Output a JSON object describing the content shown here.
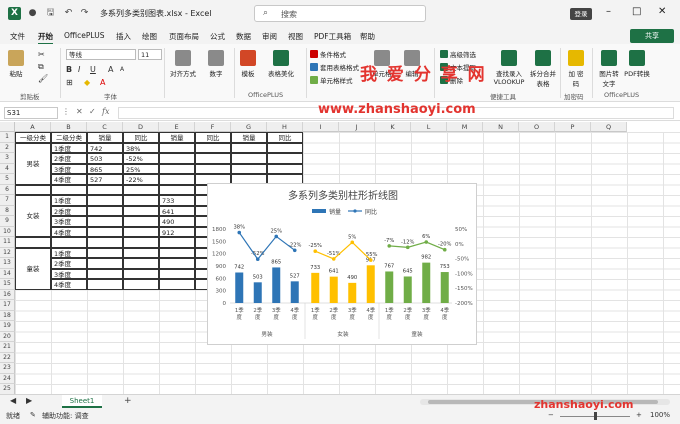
{
  "window": {
    "file_title": "多系列多类别图表.xlsx  -  Excel",
    "search_placeholder": "搜索",
    "login_label": "登录",
    "minimize_icon": "–",
    "restore_icon": "□",
    "close_icon": "✕"
  },
  "menu": {
    "tabs": [
      "文件",
      "开始",
      "OfficePLUS",
      "插入",
      "绘图",
      "页面布局",
      "公式",
      "数据",
      "审阅",
      "视图",
      "PDF工具箱",
      "帮助"
    ],
    "active": "开始",
    "share_label": "共享"
  },
  "ribbon": {
    "paste_label": "粘贴",
    "clipboard_group": "剪贴板",
    "font_name": "等线",
    "font_size": "11",
    "font_group": "字体",
    "align_label": "对齐方式",
    "number_label": "数字",
    "template_label": "模板",
    "beautify_label": "表格美化",
    "officeplus_group": "OfficePLUS",
    "cond_format_label": "条件格式",
    "table_format_label": "套用表格格式",
    "cell_style_label": "单元格样式",
    "cells_label": "单元格",
    "edit_label": "编辑",
    "adv_filter_label": "高级筛选",
    "text_extract_label": "文本提取",
    "dup_label": "删除",
    "vlookup_label": "查找录入 VLOOKUP",
    "split_merge_label": "拆分合并 表格",
    "tools_group": "便捷工具",
    "encrypt_label": "加 密码",
    "encrypt_group": "加密码",
    "img_to_text_label": "图片转 文字",
    "pdf_convert_label": "PDF转换",
    "officeplus_group2": "OfficePLUS",
    "watermark_text": "我 爱 分 享 网"
  },
  "formula_bar": {
    "name_box": "S31",
    "fx_label": "fx",
    "watermark_url": "www.zhanshaoyi.com"
  },
  "grid": {
    "columns": [
      "A",
      "B",
      "C",
      "D",
      "E",
      "F",
      "G",
      "H",
      "I",
      "J",
      "K",
      "L",
      "M",
      "N",
      "O",
      "P",
      "Q"
    ],
    "rows": [
      "1",
      "2",
      "3",
      "4",
      "5",
      "6",
      "7",
      "8",
      "9",
      "10",
      "11",
      "12",
      "13",
      "14",
      "15",
      "16",
      "17",
      "18",
      "19",
      "20",
      "21",
      "22",
      "23",
      "24",
      "25"
    ],
    "header": [
      "一级分类",
      "二级分类",
      "销量",
      "同比",
      "销量",
      "同比",
      "销量",
      "同比"
    ],
    "groups": [
      {
        "name": "男装",
        "quarters": [
          "1季度",
          "2季度",
          "3季度",
          "4季度"
        ],
        "sales": [
          "742",
          "503",
          "865",
          "527"
        ],
        "yoy": [
          "38%",
          "-52%",
          "25%",
          "-22%"
        ]
      },
      {
        "name": "女装",
        "quarters": [
          "1季度",
          "2季度",
          "3季度",
          "4季度"
        ],
        "sales": [
          "733",
          "641",
          "490",
          "912"
        ],
        "yoy": [
          "",
          "",
          "",
          ""
        ]
      },
      {
        "name": "童装",
        "quarters": [
          "1季度",
          "2季度",
          "3季度",
          "4季度"
        ],
        "sales": [
          "",
          "",
          "",
          ""
        ],
        "yoy": [
          "",
          "",
          "",
          ""
        ]
      }
    ]
  },
  "chart_data": {
    "type": "bar",
    "title": "多系列多类别柱形折线图",
    "legend": [
      "销量",
      "同比"
    ],
    "legend_position": "top",
    "categories": [
      "1季度",
      "2季度",
      "3季度",
      "4季度"
    ],
    "groups": [
      "男装",
      "女装",
      "童装"
    ],
    "series": [
      {
        "name": "销量",
        "kind": "bar",
        "axis": "left",
        "values": [
          [
            742,
            503,
            865,
            527
          ],
          [
            733,
            641,
            490,
            917
          ],
          [
            767,
            645,
            982,
            753
          ]
        ]
      },
      {
        "name": "同比",
        "kind": "line",
        "axis": "right",
        "values": [
          [
            38,
            -52,
            25,
            -22
          ],
          [
            -25,
            -51,
            5,
            -55
          ],
          [
            -7,
            -12,
            6,
            -20
          ]
        ]
      }
    ],
    "value_labels": [
      [
        "742",
        "503",
        "865",
        "527"
      ],
      [
        "733",
        "641",
        "490",
        "917"
      ],
      [
        "767",
        "645",
        "982",
        "753"
      ]
    ],
    "pct_labels": [
      [
        "38%",
        "-52%",
        "25%",
        "-22%"
      ],
      [
        "-25%",
        "-51%",
        "5%",
        "-55%"
      ],
      [
        "-7%",
        "-12%",
        "6%",
        "-20%"
      ]
    ],
    "group_colors": [
      "#2e75b6",
      "#ffc000",
      "#70ad47"
    ],
    "y_left": {
      "ticks": [
        "1800",
        "1500",
        "1200",
        "900",
        "600",
        "300",
        "0"
      ],
      "range": [
        0,
        1800
      ]
    },
    "y_right": {
      "ticks": [
        "50%",
        "0%",
        "-50%",
        "-100%",
        "-150%",
        "-200%"
      ],
      "range": [
        -200,
        50
      ]
    },
    "grid": false
  },
  "sheet_tabs": {
    "active": "Sheet1",
    "add_icon": "+"
  },
  "status": {
    "ready": "就绪",
    "accessibility": "辅助功能: 调查",
    "zoom": "100%",
    "watermark_bottom": "zhanshaoyi.com"
  }
}
